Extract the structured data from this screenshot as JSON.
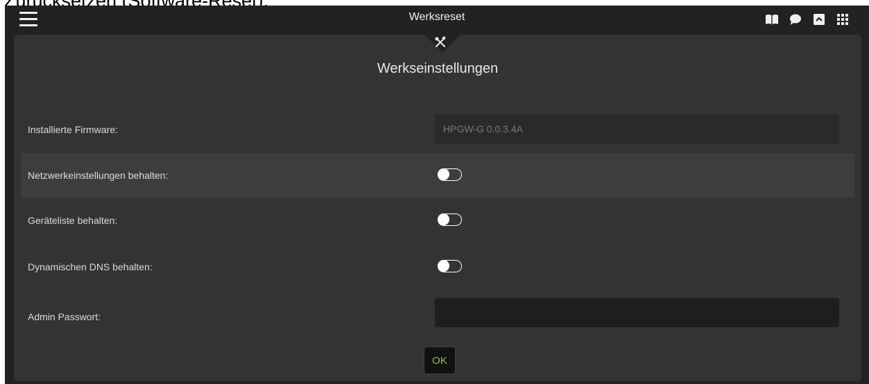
{
  "caption": "Zurücksetzen (Software-Reset).",
  "topbar": {
    "title": "Werksreset",
    "icons": [
      "menu-icon",
      "book-icon",
      "chat-bubble-icon",
      "chevron-up-box-icon",
      "apps-grid-icon"
    ]
  },
  "panel": {
    "title": "Werkseinstellungen",
    "header_icon": "tools-icon",
    "firmware": {
      "label": "Installierte Firmware:",
      "value": "HPGW-G 0.0.3.4A"
    },
    "keep_network": {
      "label": "Netzwerkeinstellungen behalten:",
      "on": false
    },
    "keep_devices": {
      "label": "Geräteliste behalten:",
      "on": false
    },
    "keep_dns": {
      "label": "Dynamischen DNS behalten:",
      "on": false
    },
    "admin_password": {
      "label": "Admin Passwort:",
      "value": "",
      "placeholder": ""
    },
    "ok_label": "OK"
  },
  "colors": {
    "accent": "#8cc63f",
    "background": "#222222",
    "panel": "#333333"
  }
}
